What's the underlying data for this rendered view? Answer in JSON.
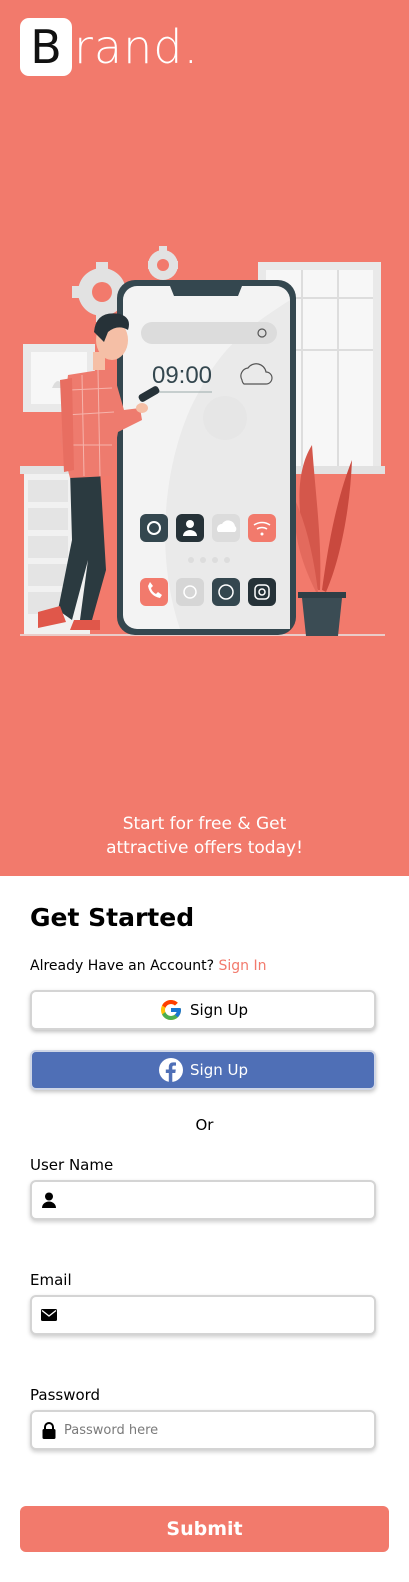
{
  "brand": {
    "initial": "B",
    "rest": "rand."
  },
  "hero": {
    "background": "#F27A6C",
    "tagline_line1": "Start for free & Get",
    "tagline_line2": "attractive offers today!",
    "phone_time": "09:00"
  },
  "form": {
    "title": "Get Started",
    "already_text": "Already Have an Account?",
    "sign_in_label": "Sign In",
    "google_button": {
      "label": "Sign Up",
      "icon": "google-icon"
    },
    "facebook_button": {
      "label": "Sign Up",
      "icon": "facebook-icon",
      "color": "#4F6FB6"
    },
    "or_text": "Or",
    "username": {
      "label": "User Name",
      "icon": "user-icon",
      "placeholder": ""
    },
    "email": {
      "label": "Email",
      "icon": "envelope-icon",
      "placeholder": ""
    },
    "password": {
      "label": "Password",
      "icon": "lock-icon",
      "placeholder": "Password here"
    },
    "submit_label": "Submit"
  }
}
